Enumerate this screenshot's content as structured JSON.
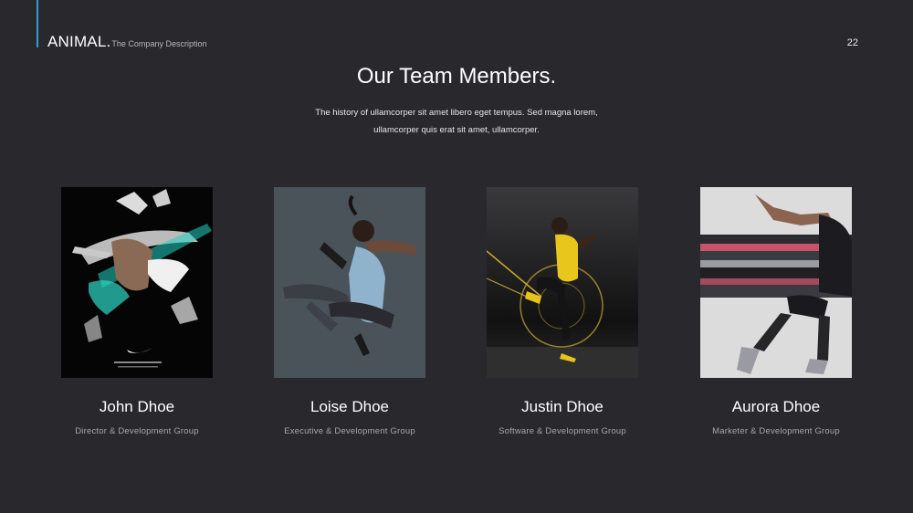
{
  "brand": {
    "name": "ANIMAL.",
    "description": "The Company Description"
  },
  "page_number": "22",
  "title": "Our Team Members.",
  "intro": [
    "The history of ullamcorper sit amet libero eget tempus. Sed magna lorem,",
    "ullamcorper quis erat sit amet, ullamcorper."
  ],
  "members": [
    {
      "name": "John Dhoe",
      "role": "Director & Development Group"
    },
    {
      "name": "Loise Dhoe",
      "role": "Executive & Development Group"
    },
    {
      "name": "Justin Dhoe",
      "role": "Software & Development Group"
    },
    {
      "name": "Aurora Dhoe",
      "role": "Marketer & Development Group"
    }
  ],
  "colors": {
    "background": "#29282d",
    "accent": "#2f9fd6"
  }
}
